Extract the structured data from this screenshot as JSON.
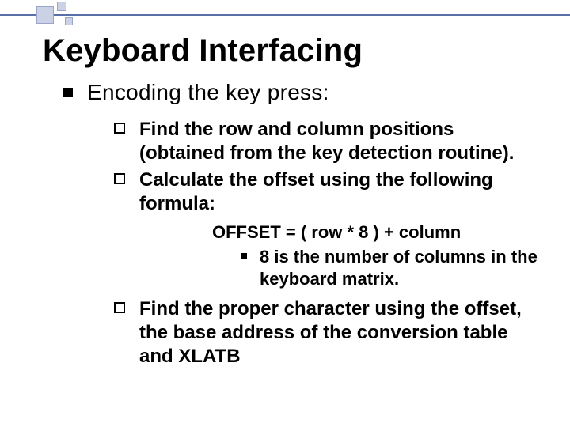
{
  "title": "Keyboard Interfacing",
  "lvl1": {
    "text": "Encoding the key press:"
  },
  "sub": [
    {
      "text": "Find the row and column positions (obtained from the key detection routine)."
    },
    {
      "text": "Calculate the offset using the following formula:"
    },
    {
      "text": "Find the proper character using the offset, the base address of the conversion table and XLATB"
    }
  ],
  "formula": "OFFSET = ( row * 8 ) + column",
  "note": "8 is the number of columns in the keyboard matrix."
}
